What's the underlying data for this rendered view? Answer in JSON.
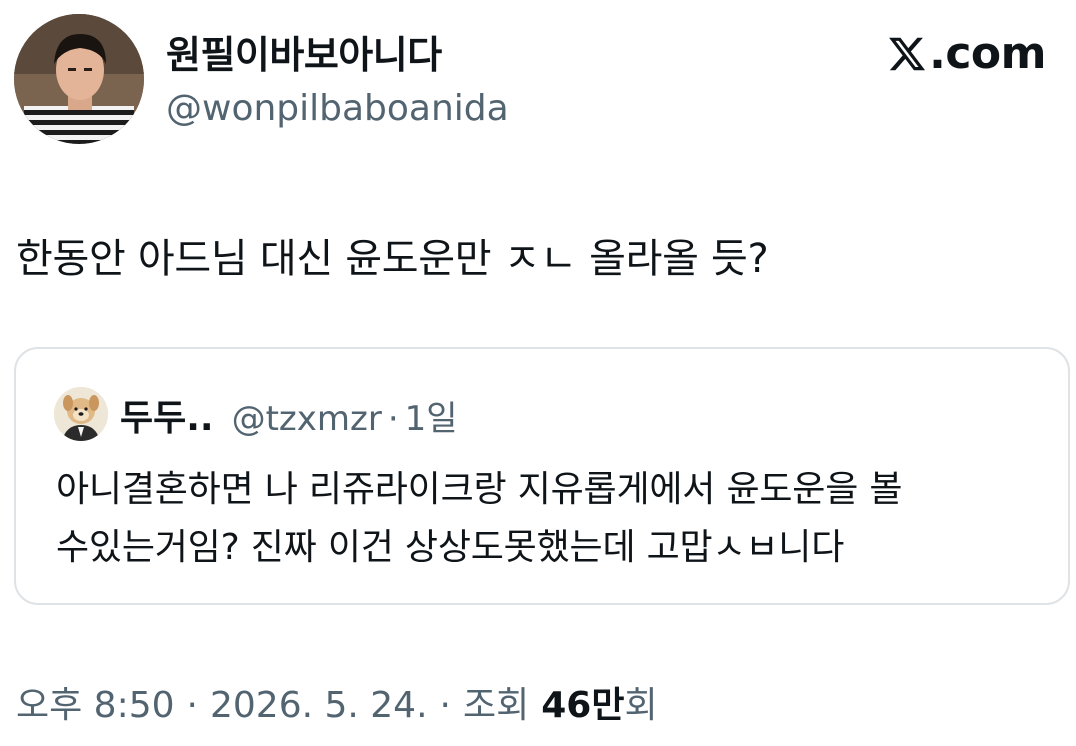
{
  "author": {
    "display_name": "원필이바보아니다",
    "handle": "@wonpilbaboanida"
  },
  "brand": {
    "icon": "x-logo-icon",
    "label": ".com"
  },
  "tweet": {
    "text": "한동안 아드님 대신 윤도운만 ㅈㄴ 올라올 듯?"
  },
  "quote": {
    "display_name": "두두..",
    "handle": "@tzxmzr",
    "separator": "·",
    "time": "1일",
    "lines": [
      "아니결혼하면 나 리쥬라이크랑 지유롭게에서 윤도운을 볼",
      "수있는거임? 진짜 이건 상상도못했는데 고맙ㅅㅂ니다"
    ]
  },
  "meta": {
    "time": "오후 8:50",
    "dot1": "·",
    "date": "2026. 5. 24.",
    "dot2": "·",
    "views_label": "조회",
    "views_count": "46만",
    "views_suffix": "회"
  },
  "colors": {
    "text_primary": "#0f1419",
    "text_secondary": "#536471",
    "border": "#dfe3e6",
    "background": "#ffffff"
  }
}
